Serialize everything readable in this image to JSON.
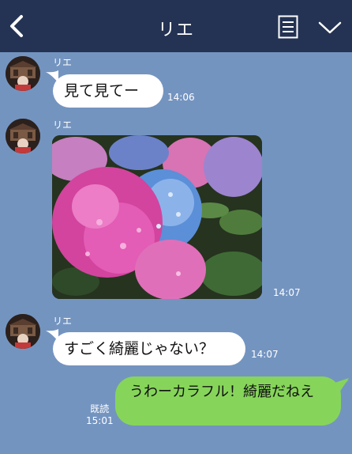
{
  "header": {
    "title": "リエ"
  },
  "icons": {
    "back": "back-chevron-icon",
    "memo": "note-list-icon",
    "menu": "chevron-down-icon"
  },
  "messages": [
    {
      "sender": "リエ",
      "text": "見て見てー",
      "time": "14:06"
    },
    {
      "sender": "リエ",
      "type": "photo",
      "photo_subject": "hydrangea",
      "time": "14:07"
    },
    {
      "sender": "リエ",
      "text": "すごく綺麗じゃない？",
      "time": "14:07"
    },
    {
      "sender": "me",
      "text": "うわーカラフル！綺麗だねえ",
      "read_label": "既読",
      "time": "15:01"
    }
  ],
  "colors": {
    "background": "#7494c0",
    "header": "#243353",
    "my_bubble": "#86d55a",
    "their_bubble": "#ffffff"
  }
}
